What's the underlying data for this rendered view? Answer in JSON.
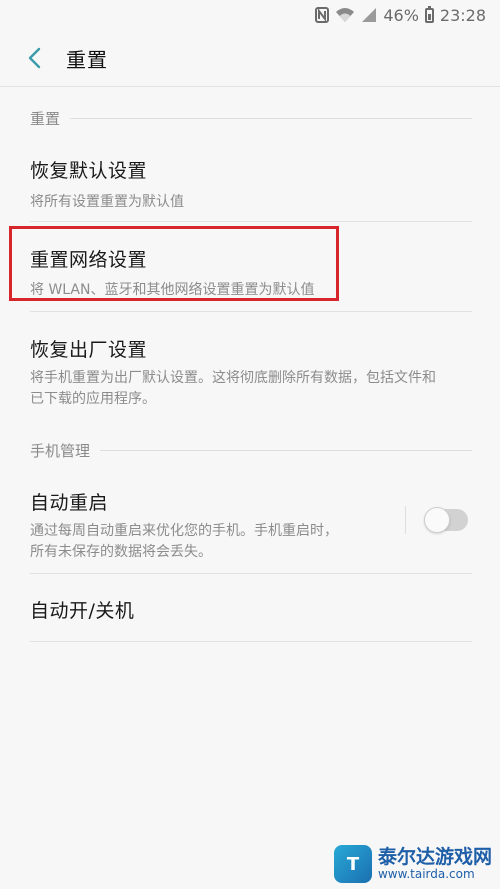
{
  "status_bar": {
    "battery": "46%",
    "time": "23:28",
    "icons": [
      "nfc-icon",
      "wifi-icon",
      "signal-icon",
      "battery-icon"
    ]
  },
  "app_bar": {
    "title": "重置",
    "back_icon": "chevron-left-icon"
  },
  "sections": [
    {
      "header": "重置",
      "items": [
        {
          "title": "恢复默认设置",
          "subtitle": "将所有设置重置为默认值"
        },
        {
          "title": "重置网络设置",
          "subtitle": "将 WLAN、蓝牙和其他网络设置重置为默认值",
          "highlighted": true
        },
        {
          "title": "恢复出厂设置",
          "subtitle_line1": "将手机重置为出厂默认设置。这将彻底删除所有数据，包括文件和",
          "subtitle_line2": "已下载的应用程序。"
        }
      ]
    },
    {
      "header": "手机管理",
      "items": [
        {
          "title": "自动重启",
          "subtitle_line1": "通过每周自动重启来优化您的手机。手机重启时，",
          "subtitle_line2": "所有未保存的数据将会丢失。",
          "toggle_on": false
        },
        {
          "title": "自动开/关机"
        }
      ]
    }
  ],
  "highlight_color": "#d7262b",
  "watermark": {
    "logo_char": "T",
    "name": "泰尔达游戏网",
    "url": "www.tairda.com"
  }
}
